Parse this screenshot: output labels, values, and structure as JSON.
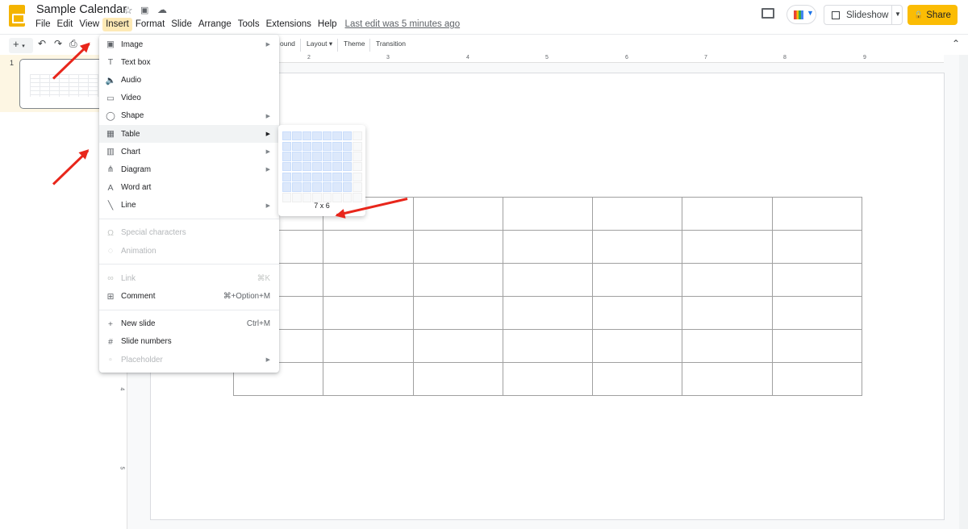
{
  "app": {
    "title": "Sample Calendar",
    "last_edit": "Last edit was 5 minutes ago"
  },
  "menubar": [
    "File",
    "Edit",
    "View",
    "Insert",
    "Format",
    "Slide",
    "Arrange",
    "Tools",
    "Extensions",
    "Help"
  ],
  "active_menu": "Insert",
  "header": {
    "slideshow_label": "Slideshow",
    "share_label": "Share"
  },
  "toolbar": {
    "background_partial": "ound",
    "layout_label": "Layout",
    "theme_label": "Theme",
    "transition_label": "Transition"
  },
  "filmstrip": {
    "slides": [
      {
        "number": "1"
      }
    ]
  },
  "ruler": {
    "h_labels": [
      "2",
      "3",
      "4",
      "5",
      "6",
      "7",
      "8",
      "9"
    ],
    "v_labels": [
      "4",
      "5"
    ]
  },
  "insert_menu": {
    "items": [
      {
        "label": "Image",
        "icon": "image-icon",
        "submenu": true
      },
      {
        "label": "Text box",
        "icon": "text-box-icon"
      },
      {
        "label": "Audio",
        "icon": "audio-icon"
      },
      {
        "label": "Video",
        "icon": "video-icon"
      },
      {
        "label": "Shape",
        "icon": "shape-icon",
        "submenu": true
      },
      {
        "label": "Table",
        "icon": "table-icon",
        "submenu": true,
        "highlighted": true
      },
      {
        "label": "Chart",
        "icon": "chart-icon",
        "submenu": true
      },
      {
        "label": "Diagram",
        "icon": "diagram-icon",
        "submenu": true
      },
      {
        "label": "Word art",
        "icon": "word-art-icon"
      },
      {
        "label": "Line",
        "icon": "line-icon",
        "submenu": true
      },
      {
        "label": "Special characters",
        "icon": "omega-icon",
        "disabled": true
      },
      {
        "label": "Animation",
        "icon": "animation-icon",
        "disabled": true
      },
      {
        "label": "Link",
        "icon": "link-icon",
        "disabled": true,
        "shortcut": "⌘K"
      },
      {
        "label": "Comment",
        "icon": "comment-icon",
        "shortcut": "⌘+Option+M"
      },
      {
        "label": "New slide",
        "icon": "plus-icon",
        "shortcut": "Ctrl+M"
      },
      {
        "label": "Slide numbers",
        "icon": "hash-icon"
      },
      {
        "label": "Placeholder",
        "icon": "placeholder-icon",
        "disabled": true,
        "submenu": true
      }
    ]
  },
  "table_picker": {
    "grid_cols": 8,
    "grid_rows": 7,
    "selected_cols": 7,
    "selected_rows": 6,
    "size_label": "7 x 6"
  },
  "slide_table": {
    "cols": 7,
    "rows": 6
  }
}
